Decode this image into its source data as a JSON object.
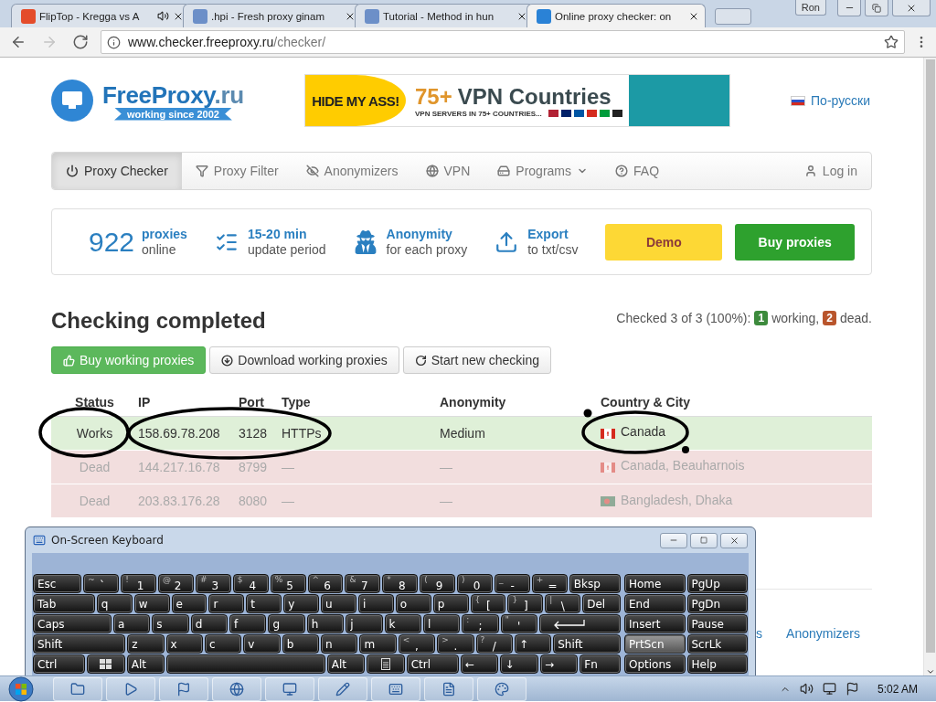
{
  "browser": {
    "tabs": [
      {
        "title": "FlipTop - Kregga vs A",
        "selected": false,
        "audio": true
      },
      {
        "title": ".hpi - Fresh proxy ginam",
        "selected": false,
        "audio": false
      },
      {
        "title": "Tutorial - Method in hun",
        "selected": false,
        "audio": false
      },
      {
        "title": "Online proxy checker: on",
        "selected": true,
        "audio": false
      }
    ],
    "profile": "Ron",
    "nav_buttons": [
      {
        "kind": "back",
        "disabled": false
      },
      {
        "kind": "forward",
        "disabled": true
      },
      {
        "kind": "reload",
        "disabled": false
      }
    ],
    "url": {
      "host": "www.checker.freeproxy.ru",
      "path": "/checker/"
    }
  },
  "site": {
    "logo": {
      "name": "FreeProxy",
      "tld": ".ru",
      "tagline": "working since 2002"
    },
    "ad": {
      "brand": "HIDE MY ASS!",
      "number": "75+",
      "headline": "VPN Countries",
      "subline": "VPN SERVERS IN 75+ COUNTRIES..."
    },
    "language_link": "По-русски",
    "nav": {
      "items": [
        {
          "label": "Proxy Checker",
          "selected": true,
          "dropdown": false
        },
        {
          "label": "Proxy Filter",
          "selected": false,
          "dropdown": false
        },
        {
          "label": "Anonymizers",
          "selected": false,
          "dropdown": false
        },
        {
          "label": "VPN",
          "selected": false,
          "dropdown": false
        },
        {
          "label": "Programs",
          "selected": false,
          "dropdown": true
        },
        {
          "label": "FAQ",
          "selected": false,
          "dropdown": false
        }
      ],
      "login": "Log in"
    },
    "stats": {
      "count": {
        "value": "922",
        "title": "proxies",
        "subtitle": "online"
      },
      "features": [
        {
          "title": "15-20 min",
          "subtitle": "update period"
        },
        {
          "title": "Anonymity",
          "subtitle": "for each proxy"
        },
        {
          "title": "Export",
          "subtitle": "to txt/csv"
        }
      ],
      "buttons": [
        {
          "label": "Demo",
          "kind": "demo"
        },
        {
          "label": "Buy proxies",
          "kind": "buy"
        }
      ]
    },
    "result": {
      "title": "Checking completed",
      "summary": {
        "text": "Checked 3 of 3 (100%):",
        "counts": [
          {
            "count": "1",
            "label": "working,",
            "color": "#3d8b3d"
          },
          {
            "count": "2",
            "label": "dead.",
            "color": "#b9552c"
          }
        ]
      },
      "actions": [
        {
          "label": "Buy working proxies",
          "kind": "primary"
        },
        {
          "label": "Download working proxies",
          "kind": "default"
        },
        {
          "label": "Start new checking",
          "kind": "default"
        }
      ],
      "table": {
        "columns": [
          "Status",
          "IP",
          "Port",
          "Type",
          "Anonymity",
          "Country & City"
        ],
        "rows": [
          {
            "kind": "working",
            "status": "Works",
            "ip": "158.69.78.208",
            "port": "3128",
            "type": "HTTPs",
            "anonymity": "Medium",
            "location": "Canada"
          },
          {
            "kind": "dead",
            "status": "Dead",
            "ip": "144.217.16.78",
            "port": "8799",
            "type": "—",
            "anonymity": "—",
            "location": "Canada, Beauharnois"
          },
          {
            "kind": "dead",
            "status": "Dead",
            "ip": "203.83.176.28",
            "port": "8080",
            "type": "—",
            "anonymity": "—",
            "location": "Bangladesh, Dhaka"
          }
        ]
      }
    },
    "footer_links": [
      "s",
      "Anonymizers"
    ]
  },
  "keyboard": {
    "title": "On-Screen Keyboard",
    "rows": [
      {
        "main": [
          {
            "kind": "key",
            "label": "Esc",
            "pressed": false
          },
          {
            "kind": "dual",
            "shift": "~",
            "label": "`",
            "pressed": false
          },
          {
            "kind": "dual",
            "shift": "!",
            "label": "1",
            "pressed": false
          },
          {
            "kind": "dual",
            "shift": "@",
            "label": "2",
            "pressed": false
          },
          {
            "kind": "dual",
            "shift": "#",
            "label": "3",
            "pressed": false
          },
          {
            "kind": "dual",
            "shift": "$",
            "label": "4",
            "pressed": false
          },
          {
            "kind": "dual",
            "shift": "%",
            "label": "5",
            "pressed": false
          },
          {
            "kind": "dual",
            "shift": "^",
            "label": "6",
            "pressed": false
          },
          {
            "kind": "dual",
            "shift": "&",
            "label": "7",
            "pressed": false
          },
          {
            "kind": "dual",
            "shift": "*",
            "label": "8",
            "pressed": false
          },
          {
            "kind": "dual",
            "shift": "(",
            "label": "9",
            "pressed": false
          },
          {
            "kind": "dual",
            "shift": ")",
            "label": "0",
            "pressed": false
          },
          {
            "kind": "dual",
            "shift": "_",
            "label": "-",
            "pressed": false
          },
          {
            "kind": "dual",
            "shift": "+",
            "label": "=",
            "pressed": false
          },
          {
            "kind": "key",
            "label": "Bksp",
            "pressed": false
          }
        ],
        "side": [
          {
            "kind": "key",
            "label": "Home",
            "pressed": false
          },
          {
            "kind": "key",
            "label": "PgUp",
            "pressed": false
          }
        ]
      },
      {
        "main": [
          {
            "kind": "key",
            "label": "Tab",
            "pressed": false
          },
          {
            "kind": "key",
            "label": "q",
            "pressed": false
          },
          {
            "kind": "key",
            "label": "w",
            "pressed": false
          },
          {
            "kind": "key",
            "label": "e",
            "pressed": false
          },
          {
            "kind": "key",
            "label": "r",
            "pressed": false
          },
          {
            "kind": "key",
            "label": "t",
            "pressed": false
          },
          {
            "kind": "key",
            "label": "y",
            "pressed": false
          },
          {
            "kind": "key",
            "label": "u",
            "pressed": false
          },
          {
            "kind": "key",
            "label": "i",
            "pressed": false
          },
          {
            "kind": "key",
            "label": "o",
            "pressed": false
          },
          {
            "kind": "key",
            "label": "p",
            "pressed": false
          },
          {
            "kind": "dual",
            "shift": "{",
            "label": "[",
            "pressed": false
          },
          {
            "kind": "dual",
            "shift": "}",
            "label": "]",
            "pressed": false
          },
          {
            "kind": "dual",
            "shift": "|",
            "label": "\\",
            "pressed": false
          },
          {
            "kind": "key",
            "label": "Del",
            "pressed": false
          }
        ],
        "side": [
          {
            "kind": "key",
            "label": "End",
            "pressed": false
          },
          {
            "kind": "key",
            "label": "PgDn",
            "pressed": false
          }
        ]
      },
      {
        "main": [
          {
            "kind": "key",
            "label": "Caps",
            "pressed": false
          },
          {
            "kind": "key",
            "label": "a",
            "pressed": false
          },
          {
            "kind": "key",
            "label": "s",
            "pressed": false
          },
          {
            "kind": "key",
            "label": "d",
            "pressed": false
          },
          {
            "kind": "key",
            "label": "f",
            "pressed": false
          },
          {
            "kind": "key",
            "label": "g",
            "pressed": false
          },
          {
            "kind": "key",
            "label": "h",
            "pressed": false
          },
          {
            "kind": "key",
            "label": "j",
            "pressed": false
          },
          {
            "kind": "key",
            "label": "k",
            "pressed": false
          },
          {
            "kind": "key",
            "label": "l",
            "pressed": false
          },
          {
            "kind": "dual",
            "shift": ":",
            "label": ";",
            "pressed": false
          },
          {
            "kind": "dual",
            "shift": "\"",
            "label": "'",
            "pressed": false
          },
          {
            "kind": "enter",
            "pressed": false
          }
        ],
        "side": [
          {
            "kind": "key",
            "label": "Insert",
            "pressed": false
          },
          {
            "kind": "key",
            "label": "Pause",
            "pressed": false
          }
        ]
      },
      {
        "main": [
          {
            "kind": "key",
            "label": "Shift",
            "pressed": false
          },
          {
            "kind": "key",
            "label": "z",
            "pressed": false
          },
          {
            "kind": "key",
            "label": "x",
            "pressed": false
          },
          {
            "kind": "key",
            "label": "c",
            "pressed": false
          },
          {
            "kind": "key",
            "label": "v",
            "pressed": false
          },
          {
            "kind": "key",
            "label": "b",
            "pressed": false
          },
          {
            "kind": "key",
            "label": "n",
            "pressed": false
          },
          {
            "kind": "key",
            "label": "m",
            "pressed": false
          },
          {
            "kind": "dual",
            "shift": "<",
            "label": ",",
            "pressed": false
          },
          {
            "kind": "dual",
            "shift": ">",
            "label": ".",
            "pressed": false
          },
          {
            "kind": "dual",
            "shift": "?",
            "label": "/",
            "pressed": false
          },
          {
            "kind": "key",
            "label": "↑",
            "pressed": false
          },
          {
            "kind": "key",
            "label": "Shift",
            "pressed": false
          }
        ],
        "side": [
          {
            "kind": "key",
            "label": "PrtScn",
            "pressed": true
          },
          {
            "kind": "key",
            "label": "ScrLk",
            "pressed": false
          }
        ]
      },
      {
        "main": [
          {
            "kind": "key",
            "label": "Ctrl",
            "pressed": false
          },
          {
            "kind": "windows",
            "pressed": false
          },
          {
            "kind": "key",
            "label": "Alt",
            "pressed": false
          },
          {
            "kind": "space",
            "pressed": false
          },
          {
            "kind": "key",
            "label": "Alt",
            "pressed": false
          },
          {
            "kind": "menu",
            "pressed": false
          },
          {
            "kind": "key",
            "label": "Ctrl",
            "pressed": false
          },
          {
            "kind": "key",
            "label": "←",
            "pressed": false
          },
          {
            "kind": "key",
            "label": "↓",
            "pressed": false
          },
          {
            "kind": "key",
            "label": "→",
            "pressed": false
          },
          {
            "kind": "key",
            "label": "Fn",
            "pressed": false
          }
        ],
        "side": [
          {
            "kind": "key",
            "label": "Options",
            "pressed": false
          },
          {
            "kind": "key",
            "label": "Help",
            "pressed": false
          }
        ]
      }
    ]
  },
  "taskbar": {
    "clock": "5:02 AM"
  }
}
